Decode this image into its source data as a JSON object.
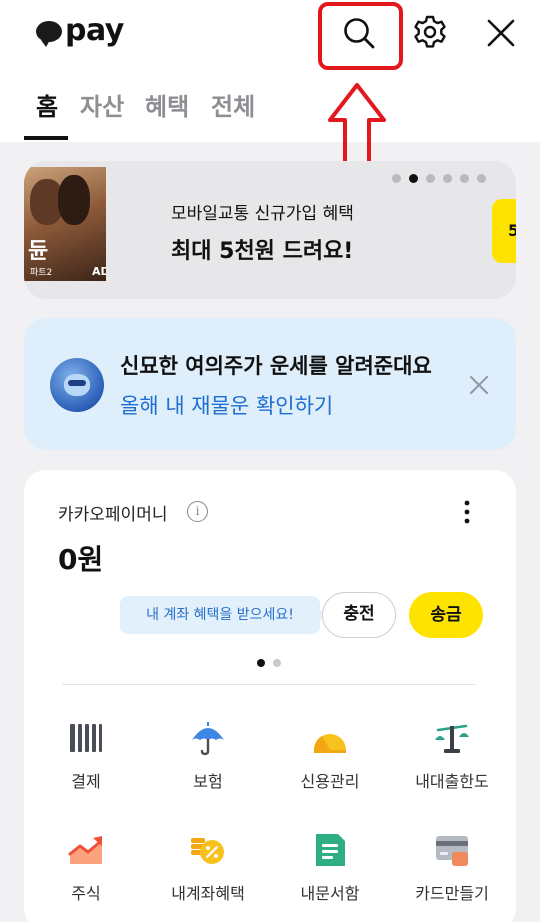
{
  "header": {
    "logo_text": "pay",
    "search_label": "검색",
    "settings_label": "설정",
    "close_label": "닫기"
  },
  "tabs": [
    {
      "label": "홈",
      "active": true
    },
    {
      "label": "자산",
      "active": false
    },
    {
      "label": "혜택",
      "active": false
    },
    {
      "label": "전체",
      "active": false
    }
  ],
  "banner": {
    "poster_title": "듄",
    "poster_subtitle": "파트2",
    "ad_label": "AD",
    "subtitle": "모바일교통 신규가입 혜택",
    "title": "최대 5천원 드려요!",
    "peek_text": "5",
    "active_index": 1,
    "dot_count": 6
  },
  "fortune": {
    "title": "신묘한 여의주가 운세를 알려준대요",
    "link": "올해 내 재물운 확인하기"
  },
  "money": {
    "label": "카카오페이머니",
    "info_symbol": "i",
    "balance": "0원",
    "tip": "내 계좌 혜택을 받으세요!",
    "charge_label": "충전",
    "send_label": "송금"
  },
  "menu": [
    {
      "label": "결제",
      "icon": "barcode-icon"
    },
    {
      "label": "보험",
      "icon": "umbrella-icon"
    },
    {
      "label": "신용관리",
      "icon": "credit-gauge-icon"
    },
    {
      "label": "내대출한도",
      "icon": "scale-icon"
    },
    {
      "label": "주식",
      "icon": "stock-chart-icon"
    },
    {
      "label": "내계좌혜택",
      "icon": "coin-percent-icon"
    },
    {
      "label": "내문서함",
      "icon": "document-icon"
    },
    {
      "label": "카드만들기",
      "icon": "card-icon"
    }
  ],
  "colors": {
    "accent_yellow": "#ffe300",
    "link_blue": "#1e6fd1",
    "highlight_red": "#e2181e"
  }
}
